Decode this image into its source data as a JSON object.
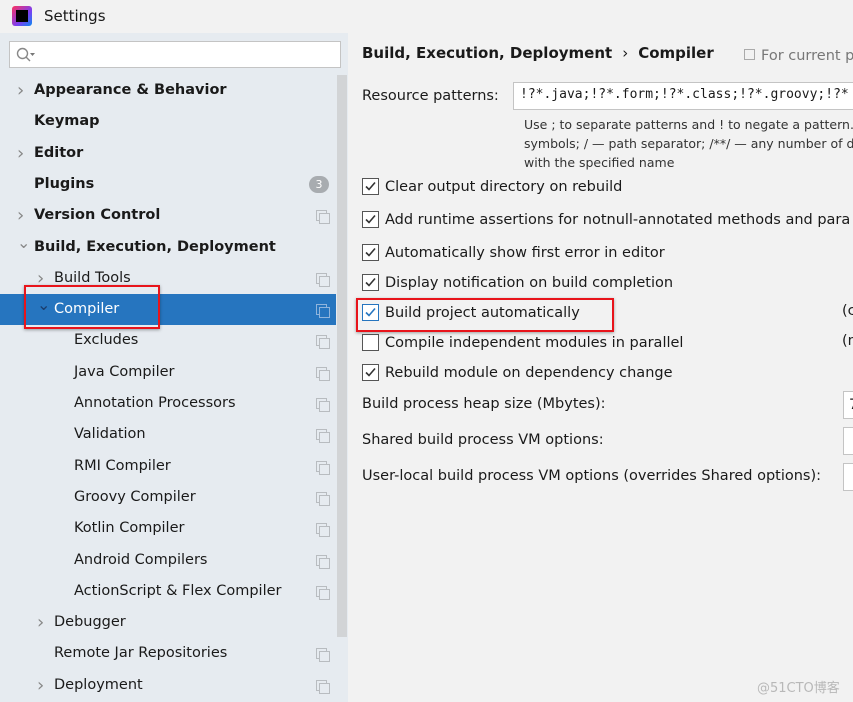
{
  "window": {
    "title": "Settings",
    "icon": "intellij-logo-icon"
  },
  "search": {
    "value": "",
    "placeholder": ""
  },
  "sidebar": {
    "items": [
      {
        "label": "Appearance & Behavior",
        "level": 0,
        "arrow": "right",
        "bold": true
      },
      {
        "label": "Keymap",
        "level": 0,
        "bold": true
      },
      {
        "label": "Editor",
        "level": 0,
        "arrow": "right",
        "bold": true
      },
      {
        "label": "Plugins",
        "level": 0,
        "bold": true,
        "badge": "3"
      },
      {
        "label": "Version Control",
        "level": 0,
        "arrow": "right",
        "bold": true,
        "copy": true
      },
      {
        "label": "Build, Execution, Deployment",
        "level": 0,
        "arrow": "down",
        "bold": true
      },
      {
        "label": "Build Tools",
        "level": 1,
        "arrow": "right",
        "copy": true
      },
      {
        "label": "Compiler",
        "level": 1,
        "arrow": "down",
        "copy": true,
        "selected": true
      },
      {
        "label": "Excludes",
        "level": 2,
        "copy": true
      },
      {
        "label": "Java Compiler",
        "level": 2,
        "copy": true
      },
      {
        "label": "Annotation Processors",
        "level": 2,
        "copy": true
      },
      {
        "label": "Validation",
        "level": 2,
        "copy": true
      },
      {
        "label": "RMI Compiler",
        "level": 2,
        "copy": true
      },
      {
        "label": "Groovy Compiler",
        "level": 2,
        "copy": true
      },
      {
        "label": "Kotlin Compiler",
        "level": 2,
        "copy": true
      },
      {
        "label": "Android Compilers",
        "level": 2,
        "copy": true
      },
      {
        "label": "ActionScript & Flex Compiler",
        "level": 2,
        "copy": true
      },
      {
        "label": "Debugger",
        "level": 1,
        "arrow": "right"
      },
      {
        "label": "Remote Jar Repositories",
        "level": 1,
        "copy": true
      },
      {
        "label": "Deployment",
        "level": 1,
        "arrow": "right",
        "copy": true
      }
    ]
  },
  "main": {
    "breadcrumb": [
      "Build, Execution, Deployment",
      "Compiler"
    ],
    "for_current": "For current p",
    "resource_label": "Resource patterns:",
    "resource_value": "!?*.java;!?*.form;!?*.class;!?*.groovy;!?*",
    "help": [
      "Use ; to separate patterns and ! to negate a pattern. A",
      "symbols; / — path separator; /**/ — any number of d",
      "with the specified name"
    ],
    "checkboxes": [
      {
        "label": "Clear output directory on rebuild",
        "checked": true
      },
      {
        "label": "Add runtime assertions for notnull-annotated methods and para",
        "checked": true
      },
      {
        "label": "Automatically show first error in editor",
        "checked": true
      },
      {
        "label": "Display notification on build completion",
        "checked": true
      },
      {
        "label": "Build project automatically",
        "checked": true,
        "side": "(c"
      },
      {
        "label": "Compile independent modules in parallel",
        "checked": false,
        "side": "(m"
      },
      {
        "label": "Rebuild module on dependency change",
        "checked": true
      }
    ],
    "fields": [
      {
        "label": "Build process heap size (Mbytes):",
        "value": "7"
      },
      {
        "label": "Shared build process VM options:",
        "value": ""
      },
      {
        "label": "User-local build process VM options (overrides Shared options):",
        "value": ""
      }
    ]
  },
  "watermark": "@51CTO博客",
  "colors": {
    "selection": "#2675bf",
    "highlight": "#e8141b",
    "sidebar_bg": "#e6ebf0",
    "panel_bg": "#f2f2f2"
  }
}
